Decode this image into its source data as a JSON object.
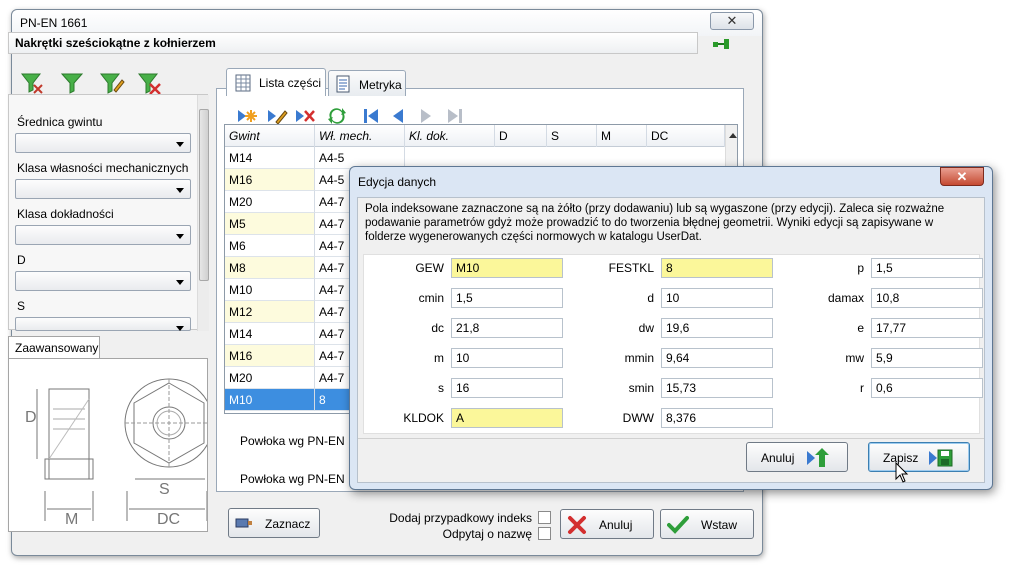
{
  "main_window": {
    "title": "PN-EN 1661",
    "close_glyph": "✕",
    "header": "Nakrętki sześciokątne z kołnierzem"
  },
  "toolbar_icons": [
    "filter-clear-icon",
    "filter-icon",
    "filter-edit-icon",
    "filter-remove-icon"
  ],
  "filters": {
    "items": [
      {
        "label": "Średnica gwintu",
        "value": ""
      },
      {
        "label": "Klasa własności mechanicznych",
        "value": ""
      },
      {
        "label": "Klasa dokładności",
        "value": ""
      },
      {
        "label": "D",
        "value": ""
      },
      {
        "label": "S",
        "value": ""
      }
    ],
    "advanced_tab": "Zaawansowany"
  },
  "drawing_labels": {
    "d": "D",
    "s": "S",
    "m": "M",
    "dc": "DC"
  },
  "tabs": [
    {
      "label": "Lista części",
      "active": true
    },
    {
      "label": "Metryka",
      "active": false
    }
  ],
  "grid": {
    "columns": [
      "Gwint",
      "Wł. mech.",
      "Kl. dok.",
      "D",
      "S",
      "M",
      "DC"
    ],
    "rows": [
      {
        "gwint": "M14",
        "wl": "A4-5"
      },
      {
        "gwint": "M16",
        "wl": "A4-5"
      },
      {
        "gwint": "M20",
        "wl": "A4-7"
      },
      {
        "gwint": "M5",
        "wl": "A4-7"
      },
      {
        "gwint": "M6",
        "wl": "A4-7"
      },
      {
        "gwint": "M8",
        "wl": "A4-7"
      },
      {
        "gwint": "M10",
        "wl": "A4-7"
      },
      {
        "gwint": "M12",
        "wl": "A4-7"
      },
      {
        "gwint": "M14",
        "wl": "A4-7"
      },
      {
        "gwint": "M16",
        "wl": "A4-7"
      },
      {
        "gwint": "M20",
        "wl": "A4-7"
      },
      {
        "gwint": "M10",
        "wl": "8"
      }
    ]
  },
  "coatings": [
    "Powłoka wg PN-EN IS",
    "Powłoka wg PN-EN IS"
  ],
  "bottom": {
    "mark_button": "Zaznacz",
    "random_index": "Dodaj przypadkowy indeks",
    "ask_name": "Odpytaj o nazwę",
    "cancel_button": "Anuluj",
    "insert_button": "Wstaw"
  },
  "dialog": {
    "title": "Edycja danych",
    "close_glyph": "✕",
    "info": "Pola indeksowane zaznaczone są na żółto (przy dodawaniu) lub są wygaszone (przy edycji).  Zaleca się rozważne podawanie parametrów gdyż może prowadzić to do tworzenia błędnej geometrii. Wyniki edycji są zapisywane w folderze wygenerowanych części normowych w katalogu UserDat.",
    "fields": [
      {
        "label": "GEW",
        "value": "M10",
        "indexed": true
      },
      {
        "label": "FESTKL",
        "value": "8",
        "indexed": true
      },
      {
        "label": "p",
        "value": "1,5",
        "indexed": false
      },
      {
        "label": "cmin",
        "value": "1,5",
        "indexed": false
      },
      {
        "label": "d",
        "value": "10",
        "indexed": false
      },
      {
        "label": "damax",
        "value": "10,8",
        "indexed": false
      },
      {
        "label": "dc",
        "value": "21,8",
        "indexed": false
      },
      {
        "label": "dw",
        "value": "19,6",
        "indexed": false
      },
      {
        "label": "e",
        "value": "17,77",
        "indexed": false
      },
      {
        "label": "m",
        "value": "10",
        "indexed": false
      },
      {
        "label": "mmin",
        "value": "9,64",
        "indexed": false
      },
      {
        "label": "mw",
        "value": "5,9",
        "indexed": false
      },
      {
        "label": "s",
        "value": "16",
        "indexed": false
      },
      {
        "label": "smin",
        "value": "15,73",
        "indexed": false
      },
      {
        "label": "r",
        "value": "0,6",
        "indexed": false
      },
      {
        "label": "KLDOK",
        "value": "A",
        "indexed": true
      },
      {
        "label": "DWW",
        "value": "8,376",
        "indexed": false
      }
    ],
    "cancel_button": "Anuluj",
    "save_button": "Zapisz"
  },
  "colors": {
    "indexed_yellow": "#fbf79a",
    "selected_row": "#3d8ee0",
    "dialog_close": "#c54a32"
  }
}
